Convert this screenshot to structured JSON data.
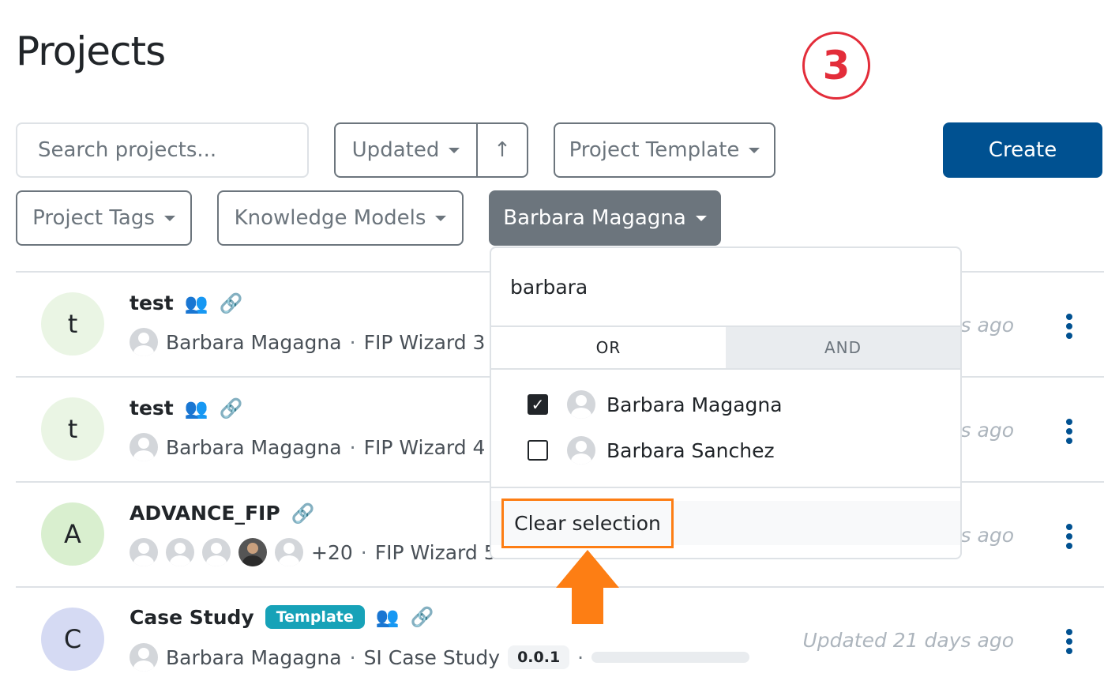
{
  "page": {
    "title": "Projects",
    "step_number": "3"
  },
  "toolbar": {
    "search_placeholder": "Search projects...",
    "sort_label": "Updated",
    "sort_direction_icon": "↑",
    "template_filter": "Project Template",
    "tags_filter": "Project Tags",
    "km_filter": "Knowledge Models",
    "user_filter": "Barbara Magagna",
    "create_label": "Create"
  },
  "dropdown": {
    "search_value": "barbara",
    "tab_or": "OR",
    "tab_and": "AND",
    "users": [
      {
        "name": "Barbara Magagna",
        "checked": true
      },
      {
        "name": "Barbara Sanchez",
        "checked": false
      }
    ],
    "clear_label": "Clear selection"
  },
  "projects": [
    {
      "initial": "t",
      "title": "test",
      "owner": "Barbara Magagna",
      "template": "FIP Wizard 3",
      "updated": "ys ago",
      "avatar_color": "#eaf5e4"
    },
    {
      "initial": "t",
      "title": "test",
      "owner": "Barbara Magagna",
      "template": "FIP Wizard 4",
      "updated": "ys ago",
      "avatar_color": "#eaf5e4"
    },
    {
      "initial": "A",
      "title": "ADVANCE_FIP",
      "extra_users": "+20",
      "template": "FIP Wizard 5",
      "updated": "ys ago",
      "avatar_color": "#d9efcf"
    },
    {
      "initial": "C",
      "title": "Case Study",
      "badge": "Template",
      "owner": "Barbara Magagna",
      "template": "SI Case Study",
      "version": "0.0.1",
      "updated": "Updated 21 days ago",
      "avatar_color": "#d5daf3"
    }
  ],
  "colors": {
    "primary": "#005191",
    "secondary": "#6c757d",
    "highlight": "#fd7e14",
    "badge": "#17a2b8",
    "step": "#e32d3a"
  }
}
